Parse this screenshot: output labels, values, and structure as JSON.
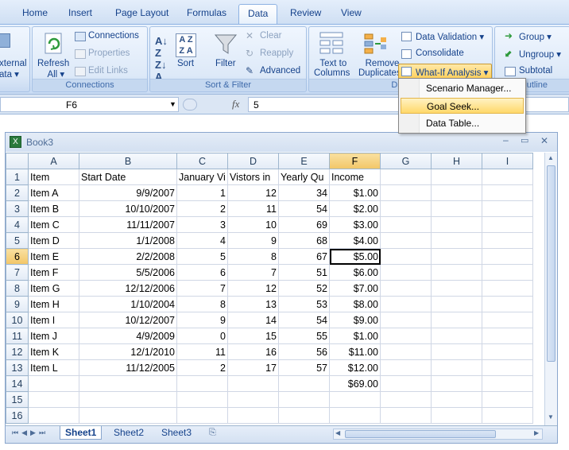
{
  "tabs": [
    "Home",
    "Insert",
    "Page Layout",
    "Formulas",
    "Data",
    "Review",
    "View"
  ],
  "active_tab": "Data",
  "ribbon": {
    "get_external": {
      "line1": "xternal",
      "line2": "ata ▾"
    },
    "refresh": {
      "line1": "Refresh",
      "line2": "All ▾"
    },
    "connections": "Connections",
    "properties": "Properties",
    "edit_links": "Edit Links",
    "connections_group": "Connections",
    "sort": "Sort",
    "filter": "Filter",
    "clear": "Clear",
    "reapply": "Reapply",
    "advanced": "Advanced",
    "sort_filter_group": "Sort & Filter",
    "text_to_columns": {
      "line1": "Text to",
      "line2": "Columns"
    },
    "remove_duplicates": {
      "line1": "Remove",
      "line2": "Duplicates"
    },
    "data_validation": "Data Validation ▾",
    "consolidate": "Consolidate",
    "what_if": "What-If Analysis ▾",
    "data_tools_group": "Data",
    "group": "Group ▾",
    "ungroup": "Ungroup ▾",
    "subtotal": "Subtotal",
    "outline_group": "utline"
  },
  "menu": {
    "items": [
      "Scenario Manager...",
      "Goal Seek...",
      "Data Table..."
    ],
    "highlighted": "Goal Seek..."
  },
  "formula_bar": {
    "name_box": "F6",
    "fx": "fx",
    "value": "5"
  },
  "workbook": {
    "title": "Book3",
    "columns": [
      "A",
      "B",
      "C",
      "D",
      "E",
      "F",
      "G",
      "H",
      "I"
    ],
    "rows": [
      [
        "Item",
        "Start Date",
        "January Vi",
        "Vistors in",
        "Yearly Qu",
        "Income",
        "",
        "",
        ""
      ],
      [
        "Item A",
        "9/9/2007",
        "1",
        "12",
        "34",
        "$1.00",
        "",
        "",
        ""
      ],
      [
        "Item B",
        "10/10/2007",
        "2",
        "11",
        "54",
        "$2.00",
        "",
        "",
        ""
      ],
      [
        "Item C",
        "11/11/2007",
        "3",
        "10",
        "69",
        "$3.00",
        "",
        "",
        ""
      ],
      [
        "Item D",
        "1/1/2008",
        "4",
        "9",
        "68",
        "$4.00",
        "",
        "",
        ""
      ],
      [
        "Item E",
        "2/2/2008",
        "5",
        "8",
        "67",
        "$5.00",
        "",
        "",
        ""
      ],
      [
        "Item F",
        "5/5/2006",
        "6",
        "7",
        "51",
        "$6.00",
        "",
        "",
        ""
      ],
      [
        "Item G",
        "12/12/2006",
        "7",
        "12",
        "52",
        "$7.00",
        "",
        "",
        ""
      ],
      [
        "Item H",
        "1/10/2004",
        "8",
        "13",
        "53",
        "$8.00",
        "",
        "",
        ""
      ],
      [
        "Item I",
        "10/12/2007",
        "9",
        "14",
        "54",
        "$9.00",
        "",
        "",
        ""
      ],
      [
        "Item J",
        "4/9/2009",
        "0",
        "15",
        "55",
        "$1.00",
        "",
        "",
        ""
      ],
      [
        "Item K",
        "12/1/2010",
        "11",
        "16",
        "56",
        "$11.00",
        "",
        "",
        ""
      ],
      [
        "Item L",
        "11/12/2005",
        "2",
        "17",
        "57",
        "$12.00",
        "",
        "",
        ""
      ],
      [
        "",
        "",
        "",
        "",
        "",
        "$69.00",
        "",
        "",
        ""
      ],
      [
        "",
        "",
        "",
        "",
        "",
        "",
        "",
        "",
        ""
      ],
      [
        "",
        "",
        "",
        "",
        "",
        "",
        "",
        "",
        ""
      ]
    ],
    "row_numbers": [
      "1",
      "2",
      "3",
      "4",
      "5",
      "6",
      "7",
      "8",
      "9",
      "10",
      "11",
      "12",
      "13",
      "14",
      "15",
      "16"
    ],
    "active_cell": "F6",
    "sheets": [
      "Sheet1",
      "Sheet2",
      "Sheet3"
    ],
    "active_sheet": "Sheet1"
  },
  "colors": {
    "accent": "#15428b",
    "selection": "#f2c667",
    "highlight": "#ffd86a"
  }
}
